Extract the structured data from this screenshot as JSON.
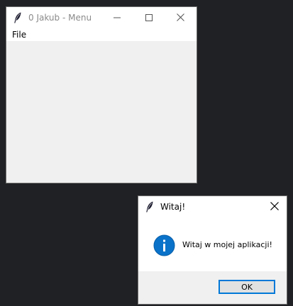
{
  "main_window": {
    "title": "0 Jakub - Menu",
    "icon": "feather-icon",
    "controls": {
      "minimize": "minimize-icon",
      "maximize": "maximize-icon",
      "close": "close-icon"
    },
    "menu": [
      {
        "label": "File"
      }
    ]
  },
  "dialog": {
    "title": "Witaj!",
    "icon": "feather-icon",
    "close": "close-icon",
    "message_icon": "info-icon",
    "message": "Witaj w mojej aplikacji!",
    "ok_label": "OK"
  },
  "colors": {
    "desktop_background": "#202124",
    "accent": "#0078d7",
    "info_icon": "#0a72c9"
  }
}
